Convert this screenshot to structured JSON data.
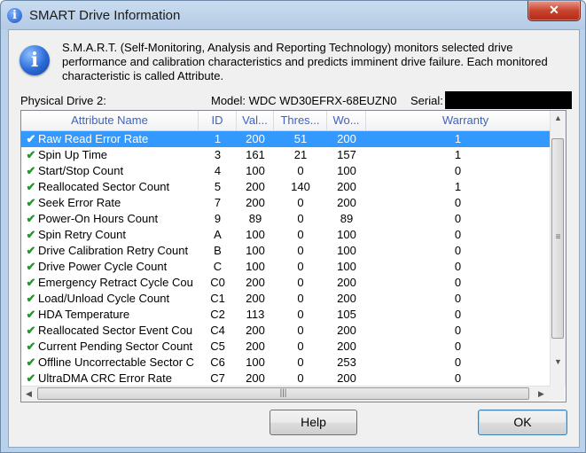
{
  "window": {
    "title": "SMART Drive Information",
    "title_icon": "info-icon",
    "close_label": "✕"
  },
  "description": "S.M.A.R.T. (Self-Monitoring, Analysis and Reporting Technology) monitors selected drive performance and calibration characteristics and predicts imminent drive failure. Each monitored characteristic is called Attribute.",
  "drive": {
    "physical_label": "Physical Drive 2:",
    "model_label": "Model: WDC WD30EFRX-68EUZN0",
    "serial_label": "Serial:"
  },
  "columns": [
    "Attribute Name",
    "ID",
    "Val...",
    "Thres...",
    "Wo...",
    "Warranty"
  ],
  "rows": [
    {
      "name": "Raw Read Error Rate",
      "id": "1",
      "val": "200",
      "thres": "51",
      "worst": "200",
      "warranty": "1",
      "selected": true
    },
    {
      "name": "Spin Up Time",
      "id": "3",
      "val": "161",
      "thres": "21",
      "worst": "157",
      "warranty": "1"
    },
    {
      "name": "Start/Stop Count",
      "id": "4",
      "val": "100",
      "thres": "0",
      "worst": "100",
      "warranty": "0"
    },
    {
      "name": "Reallocated Sector Count",
      "id": "5",
      "val": "200",
      "thres": "140",
      "worst": "200",
      "warranty": "1"
    },
    {
      "name": "Seek Error Rate",
      "id": "7",
      "val": "200",
      "thres": "0",
      "worst": "200",
      "warranty": "0"
    },
    {
      "name": "Power-On Hours Count",
      "id": "9",
      "val": "89",
      "thres": "0",
      "worst": "89",
      "warranty": "0"
    },
    {
      "name": "Spin Retry Count",
      "id": "A",
      "val": "100",
      "thres": "0",
      "worst": "100",
      "warranty": "0"
    },
    {
      "name": "Drive Calibration Retry Count",
      "id": "B",
      "val": "100",
      "thres": "0",
      "worst": "100",
      "warranty": "0"
    },
    {
      "name": "Drive Power Cycle Count",
      "id": "C",
      "val": "100",
      "thres": "0",
      "worst": "100",
      "warranty": "0"
    },
    {
      "name": "Emergency Retract Cycle Cou",
      "id": "C0",
      "val": "200",
      "thres": "0",
      "worst": "200",
      "warranty": "0"
    },
    {
      "name": "Load/Unload Cycle Count",
      "id": "C1",
      "val": "200",
      "thres": "0",
      "worst": "200",
      "warranty": "0"
    },
    {
      "name": "HDA Temperature",
      "id": "C2",
      "val": "113",
      "thres": "0",
      "worst": "105",
      "warranty": "0"
    },
    {
      "name": "Reallocated Sector Event Cou",
      "id": "C4",
      "val": "200",
      "thres": "0",
      "worst": "200",
      "warranty": "0"
    },
    {
      "name": "Current Pending Sector Count",
      "id": "C5",
      "val": "200",
      "thres": "0",
      "worst": "200",
      "warranty": "0"
    },
    {
      "name": "Offline Uncorrectable Sector C",
      "id": "C6",
      "val": "100",
      "thres": "0",
      "worst": "253",
      "warranty": "0"
    },
    {
      "name": "UltraDMA CRC Error Rate",
      "id": "C7",
      "val": "200",
      "thres": "0",
      "worst": "200",
      "warranty": "0"
    }
  ],
  "row_icon": "check-icon",
  "buttons": {
    "help": "Help",
    "ok": "OK"
  },
  "colors": {
    "selection": "#3399ff",
    "header_text": "#4061c0",
    "check": "#1f9a2a"
  }
}
